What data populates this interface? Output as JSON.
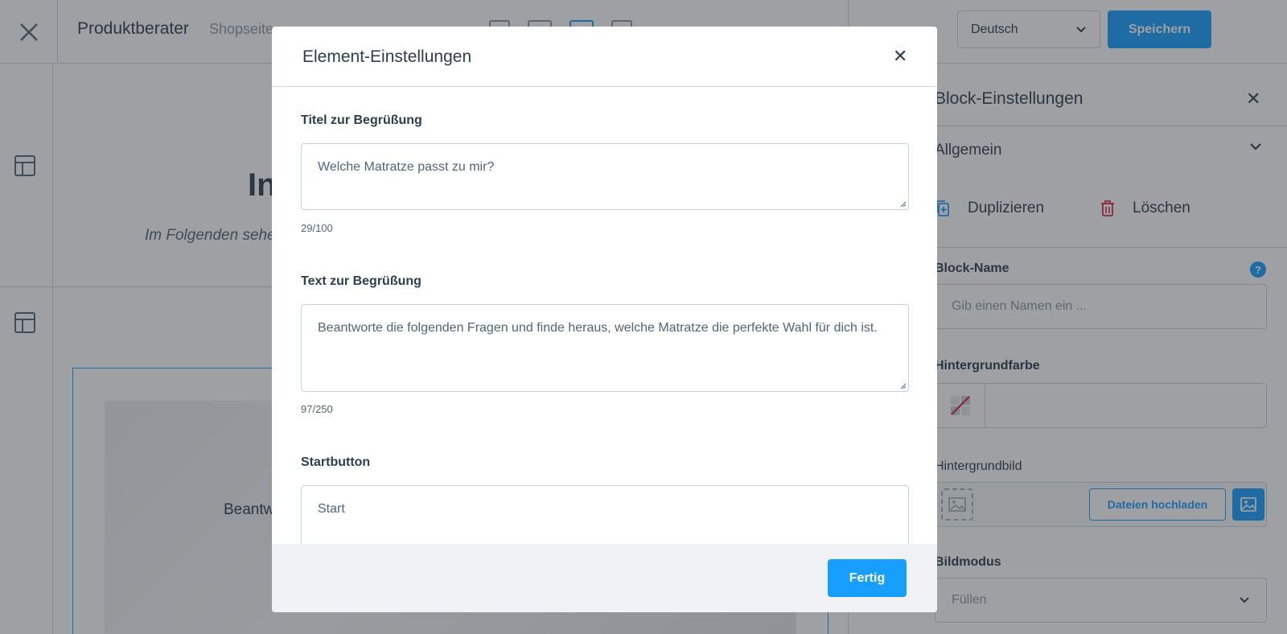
{
  "header": {
    "title": "Produktberater",
    "breadcrumb": "Shopseite",
    "language": "Deutsch",
    "save_label": "Speichern"
  },
  "canvas": {
    "heading_fragment": "In",
    "subtitle_fragment": "Im Folgenden sehen",
    "image_text_fragment": "Beantw"
  },
  "sidebar": {
    "title": "Block-Einstellungen",
    "section": "Allgemein",
    "duplicate_label": "Duplizieren",
    "delete_label": "Löschen",
    "block_name_label": "Block-Name",
    "block_name_placeholder": "Gib einen Namen ein ...",
    "bg_color_label": "Hintergrundfarbe",
    "bg_image_label": "Hintergrundbild",
    "upload_label": "Dateien hochladen",
    "image_mode_label": "Bildmodus",
    "image_mode_value": "Füllen"
  },
  "modal": {
    "title": "Element-Einstellungen",
    "fields": [
      {
        "label": "Titel zur Begrüßung",
        "value": "Welche Matratze passt zu mir?",
        "counter": "29/100"
      },
      {
        "label": "Text zur Begrüßung",
        "value": "Beantworte die folgenden Fragen und finde heraus, welche Matratze die perfekte Wahl für dich ist.",
        "counter": "97/250"
      },
      {
        "label": "Startbutton",
        "value": "Start"
      }
    ],
    "done_label": "Fertig"
  },
  "colors": {
    "accent": "#189eff",
    "text": "#2f3e4e",
    "danger": "#de294c"
  }
}
